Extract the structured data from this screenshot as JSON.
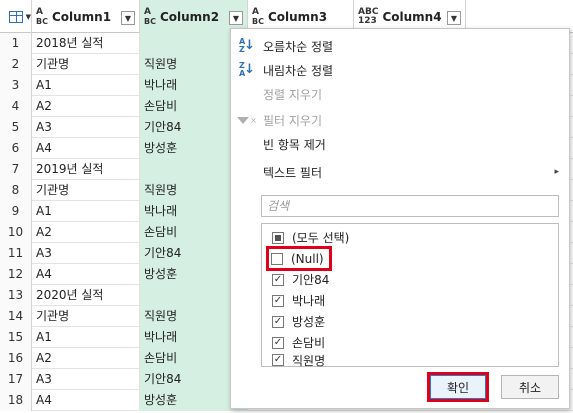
{
  "columns": [
    {
      "type": "ABC",
      "name": "Column1"
    },
    {
      "type": "ABC",
      "name": "Column2"
    },
    {
      "type": "ABC",
      "name": "Column3"
    },
    {
      "type": "ABC123",
      "name": "Column4"
    }
  ],
  "type_labels": {
    "abc_top": "A",
    "abc_bottom": "BC",
    "abc123_top": "ABC",
    "abc123_bottom": "123"
  },
  "rows": [
    {
      "n": "1",
      "c1": "2018년 실적",
      "c2": ""
    },
    {
      "n": "2",
      "c1": "기관명",
      "c2": "직원명"
    },
    {
      "n": "3",
      "c1": "A1",
      "c2": "박나래"
    },
    {
      "n": "4",
      "c1": "A2",
      "c2": "손담비"
    },
    {
      "n": "5",
      "c1": "A3",
      "c2": "기안84"
    },
    {
      "n": "6",
      "c1": "A4",
      "c2": "방성훈"
    },
    {
      "n": "7",
      "c1": "2019년 실적",
      "c2": ""
    },
    {
      "n": "8",
      "c1": "기관명",
      "c2": "직원명"
    },
    {
      "n": "9",
      "c1": "A1",
      "c2": "박나래"
    },
    {
      "n": "10",
      "c1": "A2",
      "c2": "손담비"
    },
    {
      "n": "11",
      "c1": "A3",
      "c2": "기안84"
    },
    {
      "n": "12",
      "c1": "A4",
      "c2": "방성훈"
    },
    {
      "n": "13",
      "c1": "2020년 실적",
      "c2": ""
    },
    {
      "n": "14",
      "c1": "기관명",
      "c2": "직원명"
    },
    {
      "n": "15",
      "c1": "A1",
      "c2": "박나래"
    },
    {
      "n": "16",
      "c1": "A2",
      "c2": "손담비"
    },
    {
      "n": "17",
      "c1": "A3",
      "c2": "기안84"
    },
    {
      "n": "18",
      "c1": "A4",
      "c2": "방성훈"
    }
  ],
  "menu": {
    "sort_asc": "오름차순 정렬",
    "sort_desc": "내림차순 정렬",
    "clear_sort": "정렬 지우기",
    "clear_filter": "필터 지우기",
    "remove_empty": "빈 항목 제거",
    "text_filter": "텍스트 필터",
    "search_placeholder": "검색",
    "filter_items": [
      {
        "label": "(모두 선택)",
        "state": "partial"
      },
      {
        "label": "(Null)",
        "state": "unchecked"
      },
      {
        "label": "기안84",
        "state": "checked"
      },
      {
        "label": "박나래",
        "state": "checked"
      },
      {
        "label": "방성훈",
        "state": "checked"
      },
      {
        "label": "손담비",
        "state": "checked"
      },
      {
        "label": "직원명",
        "state": "checked"
      }
    ],
    "ok_label": "확인",
    "cancel_label": "취소"
  },
  "colors": {
    "selected_column": "#d6efe3",
    "highlight": "#e0001a",
    "accent": "#2f6fb6"
  }
}
